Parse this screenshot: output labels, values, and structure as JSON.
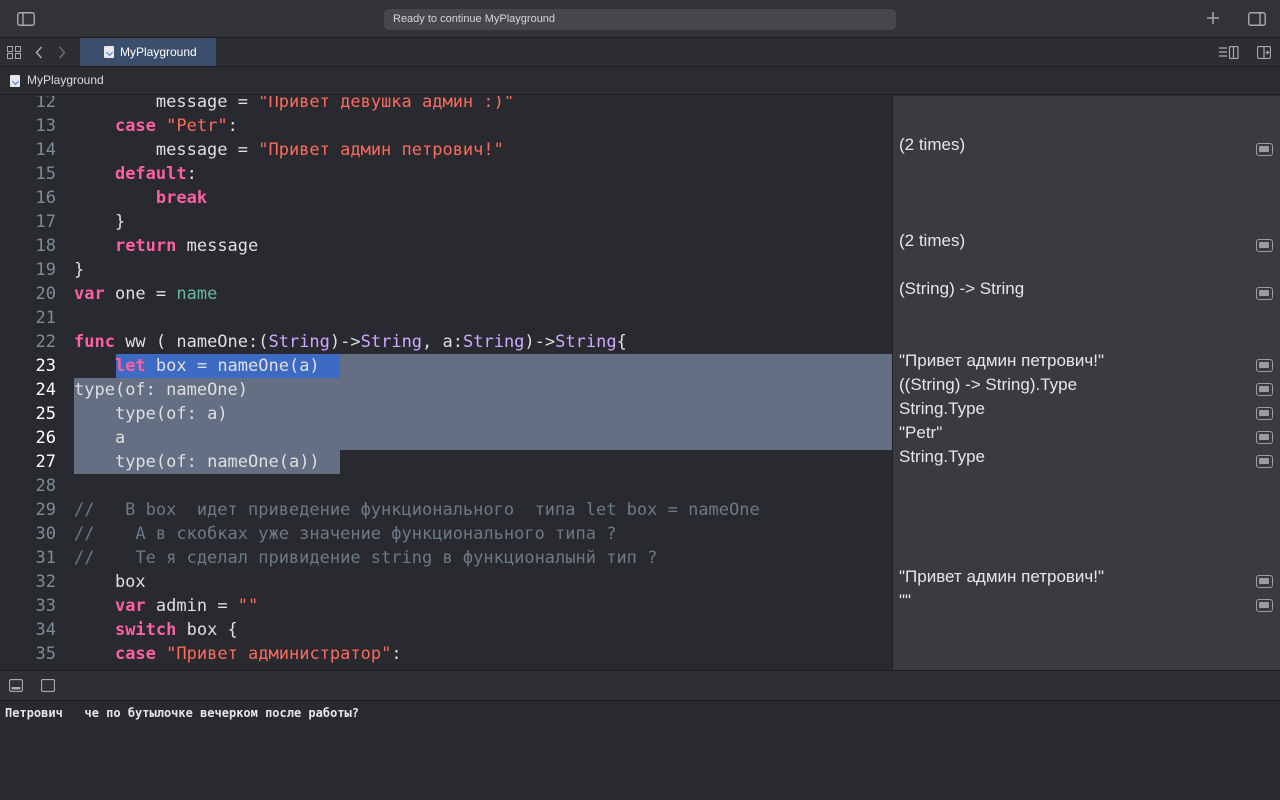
{
  "toolbar": {
    "status": "Ready to continue MyPlayground",
    "icons": [
      "sidebar-toggle-icon",
      "plus-icon",
      "inspector-toggle-icon"
    ]
  },
  "tabbar": {
    "tab_label": "MyPlayground",
    "icons": [
      "grid-icon",
      "chevron-left-icon",
      "chevron-right-icon",
      "editor-options-icon",
      "add-editor-icon"
    ]
  },
  "jumpbar": {
    "breadcrumb": "MyPlayground"
  },
  "editor": {
    "lines": [
      {
        "n": "12",
        "t": "        message = \"Привет девушка админ :)\""
      },
      {
        "n": "13",
        "t": "    case \"Petr\":"
      },
      {
        "n": "14",
        "t": "        message = \"Привет админ петрович!\""
      },
      {
        "n": "15",
        "t": "    default:"
      },
      {
        "n": "16",
        "t": "        break"
      },
      {
        "n": "17",
        "t": "    }"
      },
      {
        "n": "18",
        "t": "    return message"
      },
      {
        "n": "19",
        "t": "}"
      },
      {
        "n": "20",
        "t": "var one = name"
      },
      {
        "n": "21",
        "t": ""
      },
      {
        "n": "22",
        "t": "func ww ( nameOne:(String)->String, a:String)->String{"
      },
      {
        "n": "23",
        "t": "    let box = nameOne(a)"
      },
      {
        "n": "24",
        "t": "type(of: nameOne)"
      },
      {
        "n": "25",
        "t": "    type(of: a)"
      },
      {
        "n": "26",
        "t": "    a"
      },
      {
        "n": "27",
        "t": "    type(of: nameOne(a))"
      },
      {
        "n": "28",
        "t": ""
      },
      {
        "n": "29",
        "t": "//   В box  идет приведение функционального  типа let box = nameOne"
      },
      {
        "n": "30",
        "t": "//    А в скобках уже значение функционального типа ?"
      },
      {
        "n": "31",
        "t": "//    Те я сделал привидение string в функционалынй тип ?"
      },
      {
        "n": "32",
        "t": "    box"
      },
      {
        "n": "33",
        "t": "    var admin = \"\""
      },
      {
        "n": "34",
        "t": "    switch box {"
      },
      {
        "n": "35",
        "t": "    case \"Привет администратор\":"
      }
    ],
    "highlight": {
      "from_line": "23",
      "to_line": "27"
    }
  },
  "results": {
    "entries": [
      {
        "line": "14",
        "text": "(2 times)"
      },
      {
        "line": "18",
        "text": "(2 times)"
      },
      {
        "line": "20",
        "text": "(String) -> String"
      },
      {
        "line": "23",
        "text": "\"Привет админ петрович!\""
      },
      {
        "line": "24",
        "text": "((String) -> String).Type"
      },
      {
        "line": "25",
        "text": "String.Type"
      },
      {
        "line": "26",
        "text": "\"Petr\""
      },
      {
        "line": "27",
        "text": "String.Type"
      },
      {
        "line": "32",
        "text": "\"Привет админ петрович!\""
      },
      {
        "line": "33",
        "text": "\"\""
      }
    ]
  },
  "debugbar": {
    "icons": [
      "hide-debug-area-icon",
      "show-console-icon"
    ]
  },
  "console": {
    "output": "Петрович   че по бутылочке вечерком после работы?"
  },
  "colors": {
    "background": "#292a30",
    "keyword": "#fc5fa3",
    "string": "#fc6a5d",
    "type": "#d0a8ff",
    "identifier": "#67b7a4",
    "comment": "#6c7986",
    "selection": "#646f83",
    "selection_active": "#3d6bc3",
    "tab_active": "#3b4f6c"
  }
}
